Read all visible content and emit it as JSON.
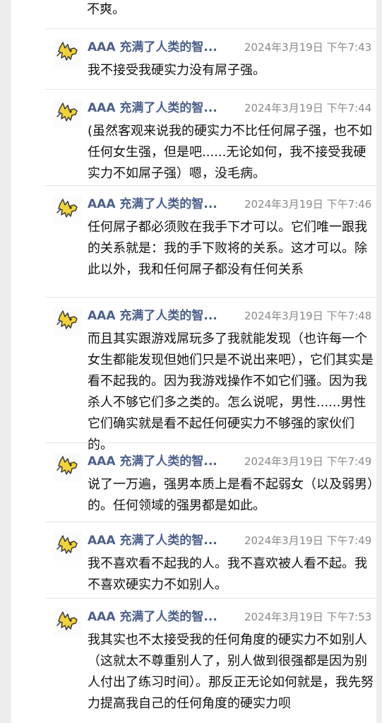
{
  "top_fragment": "不爽。",
  "messages": [
    {
      "sender": "AAA 充满了人类的智...",
      "time": "2024年3月19日 下午7:43",
      "text": "我不接受我硬实力没有屌子强。"
    },
    {
      "sender": "AAA 充满了人类的智...",
      "time": "2024年3月19日 下午7:44",
      "text": "(虽然客观来说我的硬实力不比任何屌子强，也不如任何女生强，但是吧......无论如何，我不接受我硬实力不如屌子强）嗯，没毛病。"
    },
    {
      "sender": "AAA 充满了人类的智...",
      "time": "2024年3月19日 下午7:46",
      "text": "任何屌子都必须败在我手下才可以。它们唯一跟我的关系就是：我的手下败将的关系。这才可以。除此以外，我和任何屌子都没有任何关系"
    },
    {
      "sender": "AAA 充满了人类的智...",
      "time": "2024年3月19日 下午7:48",
      "text": "而且其实跟游戏屌玩多了我就能发现（也许每一个女生都能发现但她们只是不说出来吧），它们其实是看不起我的。因为我游戏操作不如它们骚。因为我杀人不够它们多之类的。怎么说呢，男性......男性它们确实就是看不起任何硬实力不够强的家伙们的。"
    },
    {
      "sender": "AAA 充满了人类的智...",
      "time": "2024年3月19日 下午7:49",
      "text": "说了一万遍，强男本质上是看不起弱女（以及弱男）的。任何领域的强男都是如此。"
    },
    {
      "sender": "AAA 充满了人类的智...",
      "time": "2024年3月19日 下午7:49",
      "text": "我不喜欢看不起我的人。我不喜欢被人看不起。我不喜欢硬实力不如别人。"
    },
    {
      "sender": "AAA 充满了人类的智...",
      "time": "2024年3月19日 下午7:53",
      "text": "我其实也不太接受我的任何角度的硬实力不如别人（这就太不尊重别人了，别人做到很强都是因为别人付出了练习时间）。那反正无论如何就是，我先努力提高我自己的任何角度的硬实力呗"
    }
  ],
  "colors": {
    "background": "#ededed",
    "panel": "#ffffff",
    "sender_name": "#4c5f8a",
    "timestamp": "#8a8a8a",
    "message_text": "#111111",
    "divider": "#e6e6e6",
    "avatar_figure": "#f2d23a"
  },
  "icons": {
    "avatar": "yellow-fox-cartoon-icon"
  }
}
